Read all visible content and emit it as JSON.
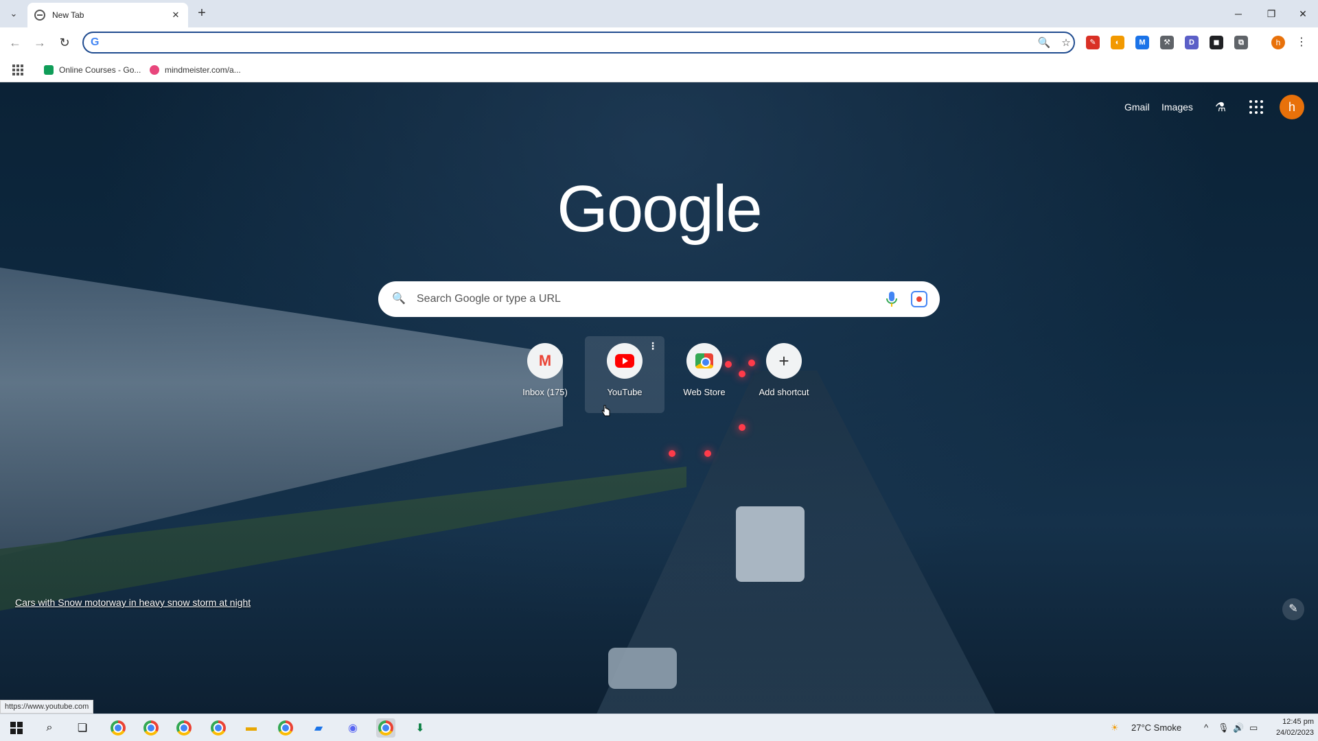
{
  "tabstrip": {
    "tab_title": "New Tab",
    "close_glyph": "✕",
    "new_tab_glyph": "+",
    "tab_list_glyph": "⌄",
    "window_controls": {
      "minimize": "─",
      "restore": "❐",
      "close": "✕"
    }
  },
  "toolbar": {
    "back_glyph": "←",
    "forward_glyph": "→",
    "reload_glyph": "↻",
    "omnibox_value": "",
    "omnibox_g": "G",
    "zoom_glyph": "🔍",
    "star_glyph": "☆",
    "extensions": [
      {
        "name": "pen-extension-icon",
        "glyph": "✎",
        "color": "#d93025"
      },
      {
        "name": "circle-extension-icon",
        "glyph": "◐",
        "color": "#f29900"
      },
      {
        "name": "mail-extension-icon",
        "glyph": "M",
        "color": "#1a73e8"
      },
      {
        "name": "tools-extension-icon",
        "glyph": "⚒",
        "color": "#5f6368"
      },
      {
        "name": "d-extension-icon",
        "glyph": "D",
        "color": "#5b5fc7"
      },
      {
        "name": "screen-extension-icon",
        "glyph": "◼",
        "color": "#202124"
      },
      {
        "name": "puzzle-extension-icon",
        "glyph": "⧉",
        "color": "#5f6368"
      }
    ],
    "profile_initial": "h",
    "menu_glyph": "⋮"
  },
  "bookmarks": [
    {
      "label": "Online Courses - Go...",
      "color": "#0f9d58"
    },
    {
      "label": "mindmeister.com/a...",
      "color": "#e8467c"
    }
  ],
  "newtab": {
    "top_links": {
      "gmail": "Gmail",
      "images": "Images"
    },
    "labs_glyph": "⚗",
    "profile_initial": "h",
    "logo": "Google",
    "search_placeholder": "Search Google or type a URL",
    "search_glyph": "🔍",
    "shortcuts": [
      {
        "label": "Inbox (175)",
        "icon": "gmail-icon"
      },
      {
        "label": "YouTube",
        "icon": "youtube-icon"
      },
      {
        "label": "Web Store",
        "icon": "web-store-icon"
      },
      {
        "label": "Add shortcut",
        "icon": "plus-icon"
      }
    ],
    "shortcut_more_glyph": "⋮",
    "background_caption": "Cars with Snow motorway in heavy snow storm at night",
    "customize_glyph": "✎"
  },
  "status_url": "https://www.youtube.com",
  "taskbar": {
    "weather": "27°C  Smoke",
    "time": "12:45 pm",
    "date": "24/02/2023",
    "tray_glyphs": {
      "chevron": "^",
      "mic": "🎙",
      "volume": "🔊",
      "notification": "▭"
    }
  },
  "colors": {
    "accent": "#1f4b8f",
    "profile": "#e8710a"
  }
}
